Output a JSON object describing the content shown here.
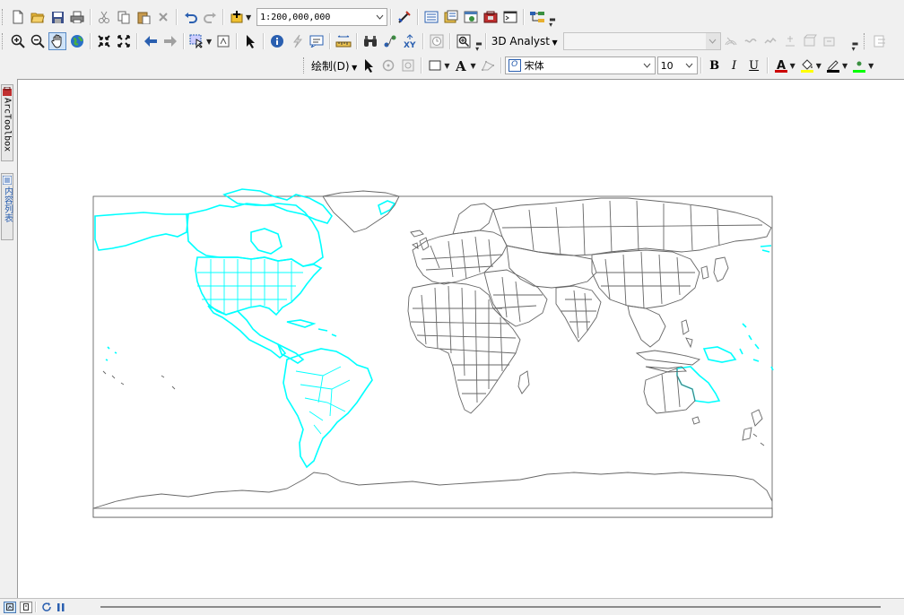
{
  "standard_toolbar": {
    "scale_value": "1:200,000,000",
    "icons": [
      "new-document-icon",
      "open-folder-icon",
      "save-icon",
      "print-icon",
      "cut-icon",
      "copy-icon",
      "paste-icon",
      "delete-icon",
      "undo-icon",
      "redo-icon",
      "add-data-icon",
      "editor-toolbar-icon",
      "table-of-contents-icon",
      "catalog-icon",
      "search-window-icon",
      "arctoolbox-icon",
      "python-window-icon",
      "model-builder-icon"
    ]
  },
  "tools_toolbar": {
    "icons": [
      "zoom-in-icon",
      "zoom-out-icon",
      "pan-hand-icon",
      "full-extent-globe-icon",
      "fixed-zoom-in-icon",
      "fixed-zoom-out-icon",
      "back-arrow-icon",
      "forward-arrow-icon",
      "select-features-icon",
      "clear-selection-icon",
      "select-elements-icon",
      "identify-icon",
      "hyperlink-icon",
      "html-popup-icon",
      "measure-icon",
      "find-binoculars-icon",
      "find-route-icon",
      "goto-xy-icon",
      "time-slider-icon",
      "viewer-window-icon"
    ],
    "analyst_label": "3D Analyst",
    "analyst_layer_value": ""
  },
  "draw_toolbar": {
    "drawing_label": "绘制(D)",
    "font_name": "宋体",
    "font_size": "10",
    "bold_label": "B",
    "italic_label": "I",
    "underline_label": "U",
    "font_color": "#cc0000",
    "fill_color": "#ffff00",
    "line_color": "#000000",
    "shadow_color": "#00ff00"
  },
  "left_dock": {
    "arctoolbox_label": "ArcToolbox",
    "toc_label": "内容列表"
  },
  "map": {
    "highlight_color": "#00ffff",
    "outline_color": "#666666",
    "selected_regions": [
      "North America",
      "Central America",
      "South America",
      "Eastern Australia",
      "Pacific Islands"
    ]
  },
  "status_bar": {
    "view_buttons": [
      "data-view-button",
      "layout-view-button",
      "refresh-button",
      "pause-drawing-button"
    ]
  }
}
